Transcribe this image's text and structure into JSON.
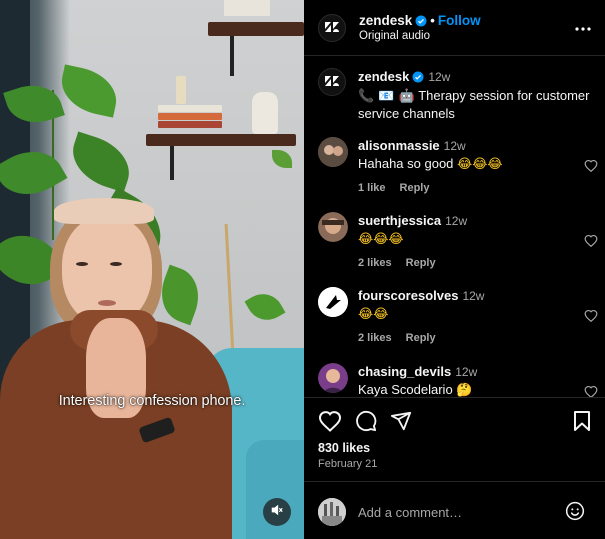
{
  "video": {
    "caption": "Interesting confession phone.",
    "mute_icon": "speaker-muted-icon"
  },
  "header": {
    "username": "zendesk",
    "separator": "•",
    "follow_label": "Follow",
    "subtitle": "Original audio",
    "more_icon": "more-horizontal-icon"
  },
  "post": {
    "username": "zendesk",
    "time": "12w",
    "caption_emojis": "📞 📧 🤖",
    "caption_text": "Therapy session for customer service channels"
  },
  "comments": [
    {
      "username": "alisonmassie",
      "time": "12w",
      "text": "Hahaha so good",
      "emoji": "😂😂😂",
      "likes": "1 like",
      "reply": "Reply"
    },
    {
      "username": "suerthjessica",
      "time": "12w",
      "text": "",
      "emoji": "😂😂😂",
      "likes": "2 likes",
      "reply": "Reply"
    },
    {
      "username": "fourscoresolves",
      "time": "12w",
      "text": "",
      "emoji": "😂😂",
      "likes": "2 likes",
      "reply": "Reply"
    },
    {
      "username": "chasing_devils",
      "time": "12w",
      "text": "Kaya Scodelario",
      "emoji": "🤔",
      "likes": "",
      "reply": ""
    }
  ],
  "actions": {
    "likes": "830 likes",
    "date": "February 21"
  },
  "composer": {
    "placeholder": "Add a comment…"
  },
  "colors": {
    "background": "#000000",
    "link_blue": "#0095f6",
    "secondary_text": "#a8a8a8",
    "divider": "#262626"
  }
}
